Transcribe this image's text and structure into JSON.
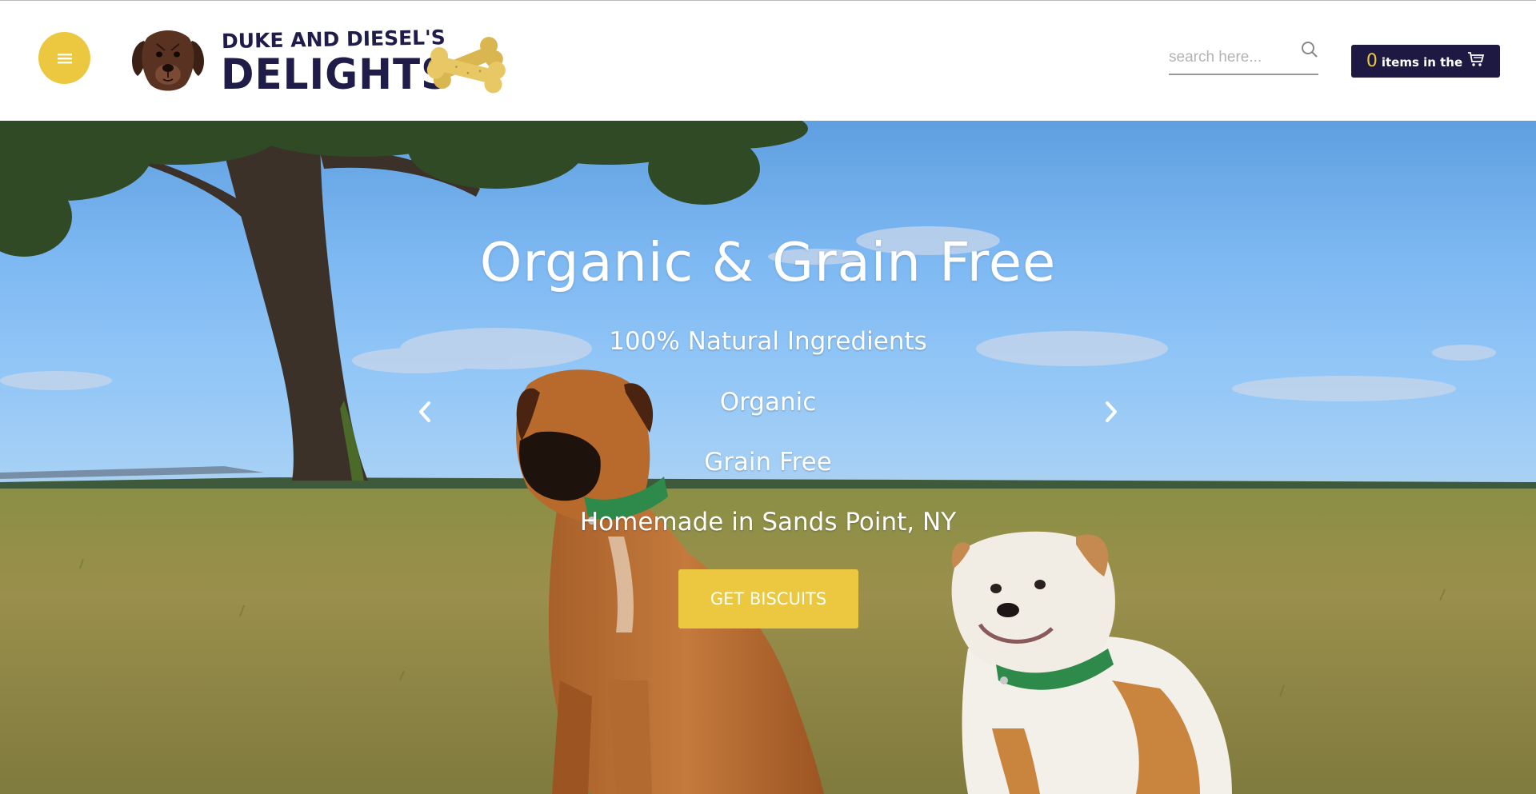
{
  "header": {
    "menu_icon": "hamburger-icon",
    "brand": {
      "line1": "DUKE AND DIESEL'S",
      "line2": "DELIGHTS"
    },
    "search": {
      "placeholder": "search here...",
      "value": "",
      "icon": "search-icon"
    },
    "cart": {
      "count": "0",
      "label": "items in the",
      "icon": "cart-icon"
    }
  },
  "hero": {
    "title": "Organic & Grain Free",
    "lines": [
      "100% Natural Ingredients",
      "Organic",
      "Grain Free",
      "Homemade in Sands Point, NY"
    ],
    "cta_label": "GET BISCUITS",
    "prev_icon": "chevron-left-icon",
    "next_icon": "chevron-right-icon"
  },
  "colors": {
    "accent_yellow": "#ebc83f",
    "brand_navy": "#1d1942",
    "sky": "#7db8f2",
    "grass": "#8a8a45"
  }
}
